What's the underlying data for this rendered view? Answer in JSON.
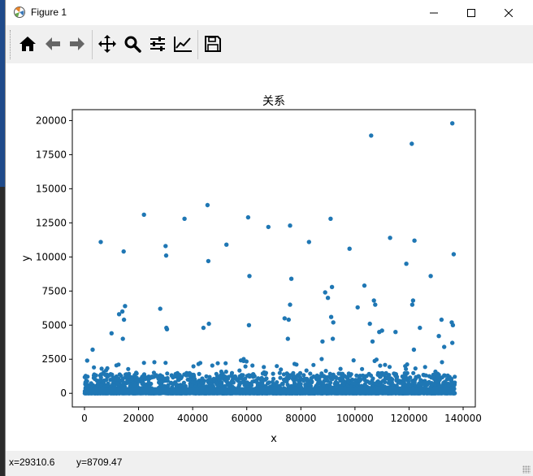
{
  "window": {
    "title": "Figure 1",
    "controls": [
      "minimize-icon",
      "maximize-icon",
      "close-icon"
    ]
  },
  "toolbar": {
    "items": [
      {
        "name": "home",
        "icon": "home-icon",
        "tooltip": "Reset original view"
      },
      {
        "name": "back",
        "icon": "arrow-left-icon",
        "tooltip": "Back to previous view"
      },
      {
        "name": "forward",
        "icon": "arrow-right-icon",
        "tooltip": "Forward to next view"
      },
      {
        "name": "pan",
        "icon": "move-icon",
        "tooltip": "Pan axes"
      },
      {
        "name": "zoom",
        "icon": "magnifier-icon",
        "tooltip": "Zoom to rectangle"
      },
      {
        "name": "subplots",
        "icon": "sliders-icon",
        "tooltip": "Configure subplots"
      },
      {
        "name": "customize",
        "icon": "line-chart-icon",
        "tooltip": "Edit axis"
      },
      {
        "name": "save",
        "icon": "save-disk-icon",
        "tooltip": "Save the figure"
      }
    ]
  },
  "status": {
    "x_readout": "x=29310.6",
    "y_readout": "y=8709.47"
  },
  "colors": {
    "marker": "#1f77b4",
    "axes_edge": "#000000",
    "figure_bg": "#ffffff",
    "toolbar_bg": "#f0f0f0"
  },
  "chart_data": {
    "type": "scatter",
    "title": "关系",
    "xlabel": "x",
    "ylabel": "y",
    "xlim": [
      -4500,
      144500
    ],
    "ylim": [
      -1000,
      20800
    ],
    "xticks": [
      0,
      20000,
      40000,
      60000,
      80000,
      100000,
      120000,
      140000
    ],
    "yticks": [
      0,
      2500,
      5000,
      7500,
      10000,
      12500,
      15000,
      17500,
      20000
    ],
    "grid": false,
    "legend": "none",
    "marker_color": "#1f77b4",
    "note_dense_band": "thousands of points spanning x 0-137000 with y mostly 0-1500",
    "dense_band": {
      "x_range": [
        0,
        137000
      ],
      "y_range": [
        0,
        1500
      ]
    },
    "outliers": {
      "x": [
        6000,
        14500,
        15000,
        14600,
        14200,
        10000,
        12800,
        14000,
        1000,
        3000,
        22000,
        28000,
        30000,
        30200,
        30500,
        30300,
        37000,
        44000,
        45500,
        45800,
        46000,
        52500,
        60500,
        61000,
        60800,
        68000,
        74000,
        76000,
        76500,
        76000,
        75500,
        75200,
        83000,
        88000,
        89000,
        90000,
        91000,
        91500,
        91200,
        92000,
        91800,
        98000,
        101000,
        103500,
        105500,
        106000,
        107000,
        107500,
        106500,
        109000,
        110000,
        113000,
        115000,
        119000,
        121000,
        121500,
        121200,
        122000,
        121800,
        124000,
        128000,
        131000,
        132000,
        133000,
        136000,
        136500,
        135800,
        136200,
        136000
      ],
      "y": [
        11100,
        10400,
        6400,
        5400,
        4000,
        4400,
        5800,
        6000,
        2400,
        3200,
        13100,
        6200,
        10800,
        10100,
        4700,
        4800,
        12800,
        4800,
        13800,
        9700,
        5100,
        10900,
        12900,
        8600,
        5000,
        12200,
        5500,
        12300,
        8400,
        6500,
        5400,
        4000,
        11100,
        3800,
        7400,
        7000,
        12800,
        7800,
        5600,
        5200,
        4000,
        10600,
        6300,
        7900,
        5100,
        18900,
        6800,
        6500,
        3800,
        4500,
        4600,
        11400,
        4500,
        9500,
        18300,
        6800,
        6500,
        11200,
        3200,
        4800,
        8600,
        4200,
        5400,
        3400,
        19800,
        10200,
        5200,
        5000,
        3700
      ]
    }
  }
}
